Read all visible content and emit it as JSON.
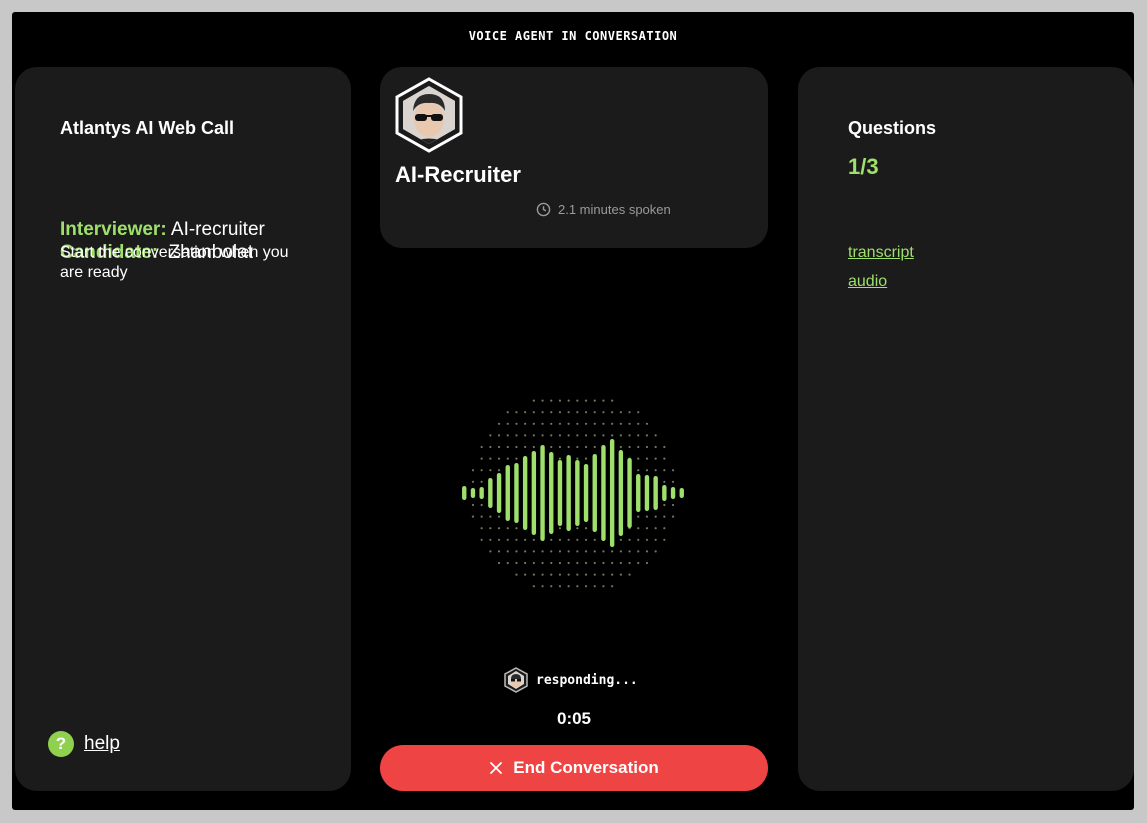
{
  "header": {
    "title": "VOICE AGENT IN CONVERSATION"
  },
  "left_panel": {
    "title": "Atlantys AI Web Call",
    "interviewer_label": "Interviewer:",
    "interviewer_value": "AI-recruiter",
    "candidate_label": "Candidate:",
    "candidate_value": "Zhanbolat",
    "hint": "Start the conversation when you are ready",
    "help": {
      "icon": "question-icon",
      "label": "help"
    }
  },
  "agent_card": {
    "name": "AI-Recruiter",
    "spoken_icon": "clock-icon",
    "spoken_text": "2.1 minutes spoken"
  },
  "status": {
    "text": "responding...",
    "timer": "0:05"
  },
  "end_button": {
    "icon": "close-icon",
    "label": "End Conversation"
  },
  "right_panel": {
    "title": "Questions",
    "count": "1/3",
    "links": [
      "transcript",
      "audio"
    ]
  },
  "colors": {
    "accent": "#9ee06b",
    "danger": "#ef4444",
    "panel": "#1b1b1b",
    "background": "#000000"
  }
}
